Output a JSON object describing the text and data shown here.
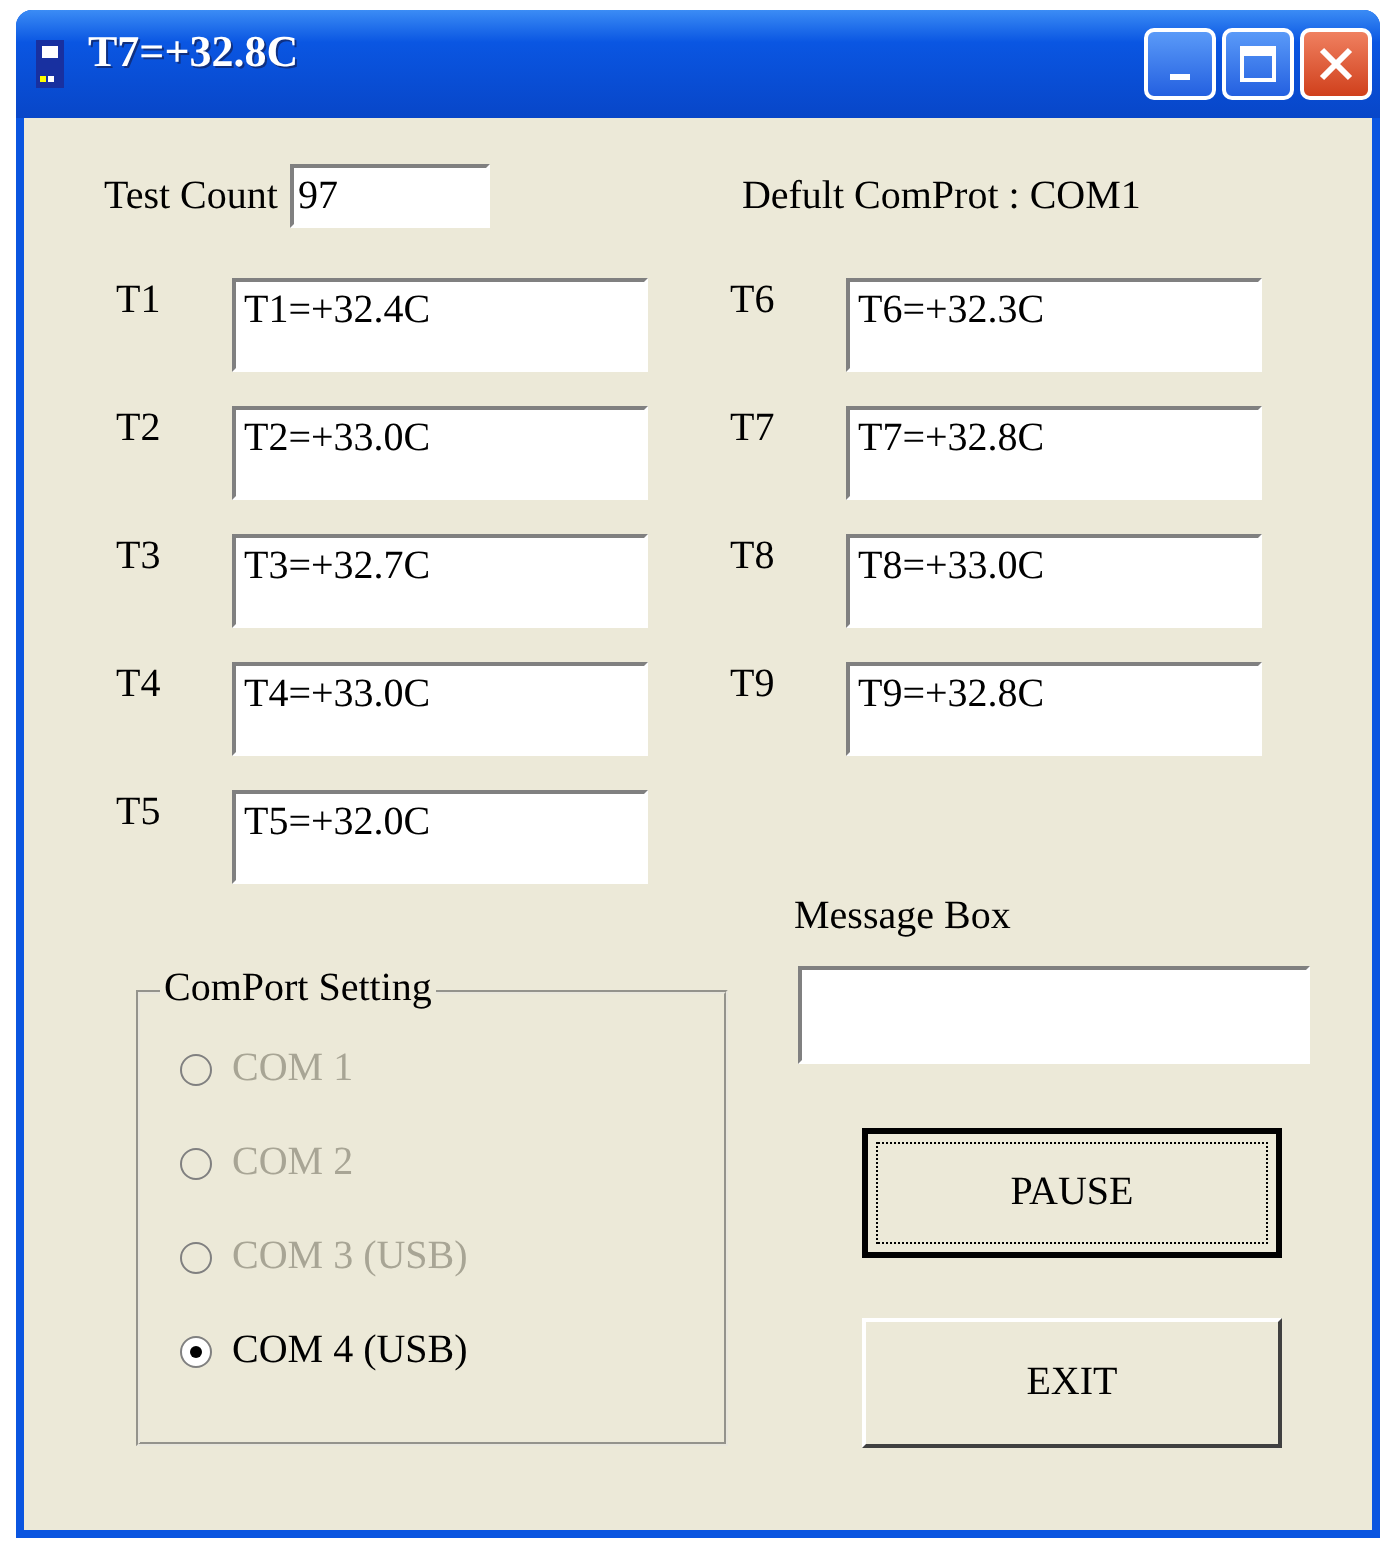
{
  "window": {
    "title": "T7=+32.8C"
  },
  "test_count": {
    "label": "Test Count",
    "value": "97"
  },
  "default_port": "Defult ComProt : COM1",
  "sensors_left": [
    {
      "label": "T1",
      "value": "T1=+32.4C"
    },
    {
      "label": "T2",
      "value": "T2=+33.0C"
    },
    {
      "label": "T3",
      "value": "T3=+32.7C"
    },
    {
      "label": "T4",
      "value": "T4=+33.0C"
    },
    {
      "label": "T5",
      "value": "T5=+32.0C"
    }
  ],
  "sensors_right": [
    {
      "label": "T6",
      "value": "T6=+32.3C"
    },
    {
      "label": "T7",
      "value": "T7=+32.8C"
    },
    {
      "label": "T8",
      "value": "T8=+33.0C"
    },
    {
      "label": "T9",
      "value": "T9=+32.8C"
    }
  ],
  "comport_setting": {
    "title": "ComPort Setting",
    "options": [
      {
        "label": "COM 1",
        "selected": false,
        "disabled": true
      },
      {
        "label": "COM 2",
        "selected": false,
        "disabled": true
      },
      {
        "label": "COM 3 (USB)",
        "selected": false,
        "disabled": true
      },
      {
        "label": "COM 4 (USB)",
        "selected": true,
        "disabled": false
      }
    ]
  },
  "message_box": {
    "label": "Message Box"
  },
  "buttons": [
    {
      "label": "PAUSE",
      "focused": true
    },
    {
      "label": "EXIT",
      "focused": false
    }
  ]
}
